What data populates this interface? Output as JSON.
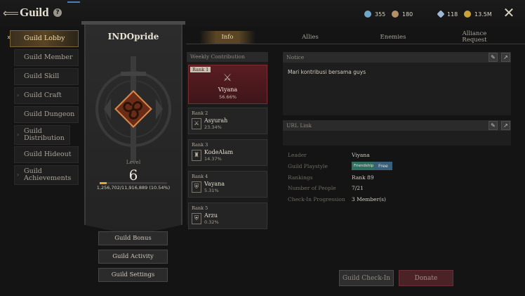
{
  "header": {
    "title": "Guild",
    "back_icon": "back-arrow-icon",
    "help_icon": "help-icon",
    "close_icon": "close-icon"
  },
  "resources": [
    {
      "name": "resource-1",
      "value": "355",
      "color": "#6fa7c9"
    },
    {
      "name": "resource-2",
      "value": "180",
      "color": "#b58f6a"
    },
    {
      "name": "resource-3",
      "value": "118",
      "color": "#9fb8d8"
    },
    {
      "name": "resource-4",
      "value": "13.5M",
      "color": "#c9a23a"
    }
  ],
  "sidebar": {
    "items": [
      {
        "label": "Guild Lobby",
        "active": true
      },
      {
        "label": "Guild Member"
      },
      {
        "label": "Guild Skill"
      },
      {
        "label": "Guild Craft"
      },
      {
        "label": "Guild Dungeon"
      },
      {
        "label": "Guild Distribution"
      },
      {
        "label": "Guild Hideout"
      },
      {
        "label": "Guild Achievements"
      }
    ]
  },
  "banner": {
    "guild_name": "INDOpride",
    "level_label": "Level",
    "level": "6",
    "xp_text": "1,256,702/11,916,889 (10.54%)",
    "xp_progress": 0.1054,
    "accent_color": "#e8a23a",
    "emblem_icon": "triskelion-emblem-icon",
    "buttons": {
      "bonus": "Guild Bonus",
      "activity": "Guild Activity",
      "settings": "Guild Settings"
    }
  },
  "tabs": [
    {
      "label": "Info",
      "active": true
    },
    {
      "label": "Allies"
    },
    {
      "label": "Enemies"
    },
    {
      "label": "Alliance Request"
    }
  ],
  "weekly": {
    "title": "Weekly Contribution",
    "ranks": [
      {
        "rank": "Rank 1",
        "name": "Viyana",
        "percent": "56.66%"
      },
      {
        "rank": "Rank 2",
        "name": "Asyurah",
        "percent": "23.34%"
      },
      {
        "rank": "Rank 3",
        "name": "KodeAlam",
        "percent": "14.37%"
      },
      {
        "rank": "Rank 4",
        "name": "Vayana",
        "percent": "5.31%"
      },
      {
        "rank": "Rank 5",
        "name": "Arzu",
        "percent": "0.32%"
      }
    ]
  },
  "notice": {
    "title": "Notice",
    "text": "Mari kontribusi bersama guys"
  },
  "url_link": {
    "title": "URL Link"
  },
  "info": {
    "leader_label": "Leader",
    "leader": "Viyana",
    "playstyle_label": "Guild Playstyle",
    "playstyle_tags": [
      "Friendship",
      "Free"
    ],
    "rankings_label": "Rankings",
    "rankings": "Rank 89",
    "people_label": "Number of People",
    "people": "7/21",
    "checkin_label": "Check-In Progression",
    "checkin": "3 Member(s)"
  },
  "actions": {
    "checkin": "Guild Check-In",
    "donate": "Donate"
  }
}
